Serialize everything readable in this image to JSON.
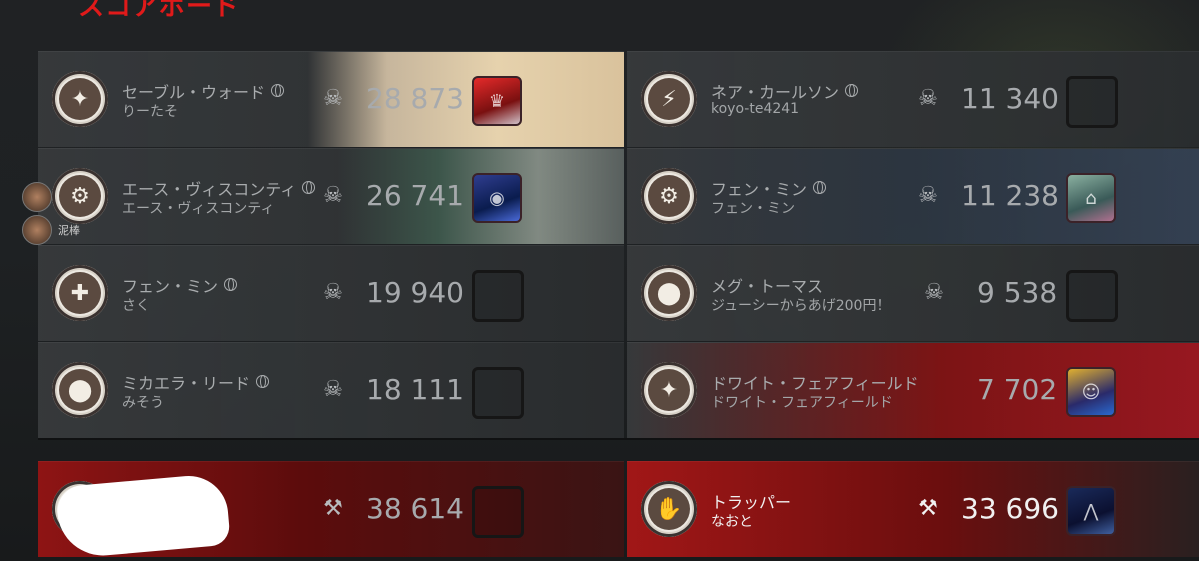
{
  "header": {
    "title": "スコアボード"
  },
  "survivors": [
    {
      "character": "セーブル・ウォード",
      "player": "りーたそ",
      "score": "28 873",
      "status": "skull",
      "emblem": "compass",
      "has_offering": true
    },
    {
      "character": "エース・ヴィスコンティ",
      "player": "エース・ヴィスコンティ",
      "score": "26 741",
      "status": "skull",
      "emblem": "gear",
      "has_offering": true
    },
    {
      "character": "フェン・ミン",
      "player": "さく",
      "score": "19 940",
      "status": "skull",
      "emblem": "heart",
      "has_offering": false
    },
    {
      "character": "ミカエラ・リード",
      "player": "みそう",
      "score": "18 111",
      "status": "skull",
      "emblem": "foot",
      "has_offering": false
    }
  ],
  "survivors_right": [
    {
      "character": "ネア・カールソン",
      "player": "koyo-te4241",
      "score": "11 340",
      "status": "skull",
      "emblem": "flashlight",
      "has_offering": false
    },
    {
      "character": "フェン・ミン",
      "player": "フェン・ミン",
      "score": "11 238",
      "status": "skull",
      "emblem": "gear",
      "has_offering": true
    },
    {
      "character": "メグ・トーマス",
      "player": "ジューシーからあげ200円！",
      "score": "9 538",
      "status": "skull",
      "emblem": "foot",
      "has_offering": false
    },
    {
      "character": "ドワイト・フェアフィールド",
      "player": "ドワイト・フェアフィールド",
      "score": "7 702",
      "status": "skull",
      "emblem": "compass",
      "has_offering": true
    }
  ],
  "killer_left": {
    "score": "38 614",
    "status": "sacrifice"
  },
  "killer_right": {
    "character": "トラッパー",
    "player": "なおと",
    "score": "33 696",
    "status": "sacrifice"
  },
  "side_friend": {
    "label": "泥棒"
  },
  "colors": {
    "killer_red": "#a11717",
    "accent": "#e01a1a"
  }
}
